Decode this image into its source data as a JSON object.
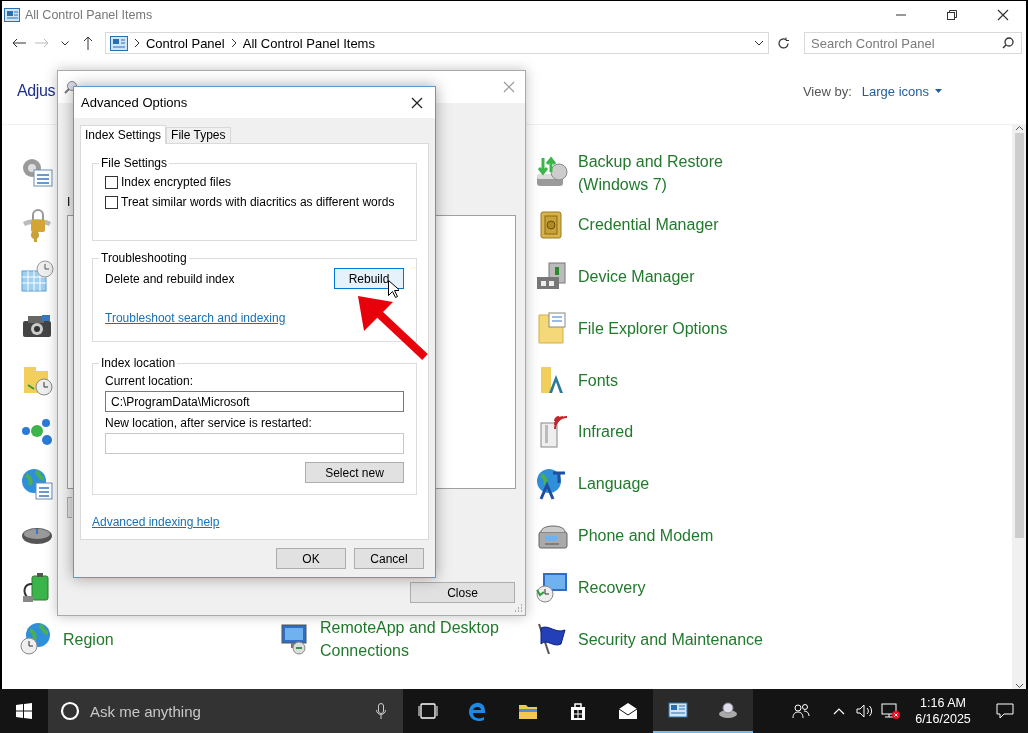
{
  "window": {
    "title": "All Control Panel Items"
  },
  "address": {
    "breadcrumbs": [
      "Control Panel",
      "All Control Panel Items"
    ],
    "search_placeholder": "Search Control Panel"
  },
  "header": {
    "title": "Adjus",
    "view_by_label": "View by:",
    "view_by_value": "Large icons"
  },
  "rows": [
    {
      "left": {
        "kind": "icon"
      },
      "right": {
        "kind": "labeled",
        "label": "Backup and Restore (Windows 7)"
      }
    },
    {
      "left": {
        "kind": "icon"
      },
      "right": {
        "kind": "labeled",
        "label": "Credential Manager"
      }
    },
    {
      "left": {
        "kind": "icon"
      },
      "right": {
        "kind": "labeled",
        "label": "Device Manager"
      }
    },
    {
      "left": {
        "kind": "icon"
      },
      "right": {
        "kind": "labeled",
        "label": "File Explorer Options"
      }
    },
    {
      "left": {
        "kind": "icon"
      },
      "right": {
        "kind": "labeled",
        "label": "Fonts"
      }
    },
    {
      "left": {
        "kind": "icon"
      },
      "right": {
        "kind": "labeled",
        "label": "Infrared"
      }
    },
    {
      "left": {
        "kind": "icon"
      },
      "right": {
        "kind": "labeled",
        "label": "Language"
      }
    },
    {
      "left": {
        "kind": "icon"
      },
      "right": {
        "kind": "labeled",
        "label": "Phone and Modem"
      }
    },
    {
      "left": {
        "kind": "icon"
      },
      "right": {
        "kind": "labeled",
        "label": "Recovery"
      }
    },
    {
      "left": {
        "kind": "labeled",
        "label": "Region"
      },
      "middle": {
        "kind": "labeled",
        "label": "RemoteApp and Desktop Connections"
      },
      "right": {
        "kind": "labeled",
        "label": "Security and Maintenance"
      }
    }
  ],
  "indexing_dialog": {
    "label_fragment": "I",
    "close_button": "Close"
  },
  "advanced_dialog": {
    "title": "Advanced Options",
    "tabs": [
      {
        "label": "Index Settings",
        "selected": true
      },
      {
        "label": "File Types",
        "selected": false
      }
    ],
    "file_settings": {
      "legend": "File Settings",
      "options": [
        {
          "label": "Index encrypted files",
          "checked": false
        },
        {
          "label": "Treat similar words with diacritics as different words",
          "checked": false
        }
      ]
    },
    "troubleshooting": {
      "legend": "Troubleshooting",
      "text": "Delete and rebuild index",
      "button": "Rebuild",
      "button_hovered": true,
      "link": "Troubleshoot search and indexing"
    },
    "index_location": {
      "legend": "Index location",
      "current_label": "Current location:",
      "current_value": "C:\\ProgramData\\Microsoft",
      "new_label": "New location, after service is restarted:",
      "button": "Select new"
    },
    "help_link": "Advanced indexing help",
    "buttons": [
      "OK",
      "Cancel"
    ]
  },
  "taskbar": {
    "search_placeholder": "Ask me anything",
    "apps": [
      {
        "active": false
      },
      {
        "active": false
      },
      {
        "active": false
      },
      {
        "active": false
      },
      {
        "active": true
      },
      {
        "active": true
      }
    ],
    "time": "1:16 AM",
    "date": "6/16/2025"
  }
}
